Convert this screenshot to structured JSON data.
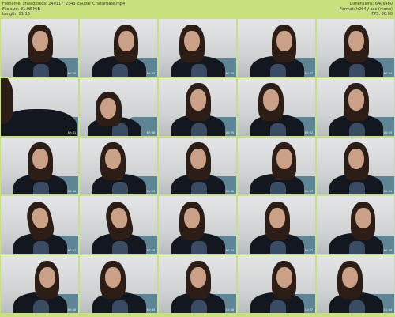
{
  "header": {
    "filename": "Filename: xheadxsexx_240117_2343_couple_Chaturbate.mp4",
    "filesize": "File size: 81.98 MiB",
    "length": "Length: 11:16",
    "dimensions": "Dimensions: 640x480",
    "format": "Format: h264 / aac (mono)",
    "fps": "FPS: 30.00"
  },
  "thumbnails": [
    {
      "time": "00:16"
    },
    {
      "time": "00:43"
    },
    {
      "time": "01:10"
    },
    {
      "time": "01:37"
    },
    {
      "time": "02:04"
    },
    {
      "time": "02:31"
    },
    {
      "time": "02:58"
    },
    {
      "time": "03:25"
    },
    {
      "time": "03:52"
    },
    {
      "time": "04:19"
    },
    {
      "time": "04:46"
    },
    {
      "time": "05:13"
    },
    {
      "time": "05:40"
    },
    {
      "time": "06:07"
    },
    {
      "time": "06:34"
    },
    {
      "time": "07:01"
    },
    {
      "time": "07:28"
    },
    {
      "time": "07:55"
    },
    {
      "time": "08:22"
    },
    {
      "time": "08:49"
    },
    {
      "time": "09:16"
    },
    {
      "time": "09:43"
    },
    {
      "time": "10:10"
    },
    {
      "time": "10:37"
    },
    {
      "time": "11:04"
    }
  ]
}
